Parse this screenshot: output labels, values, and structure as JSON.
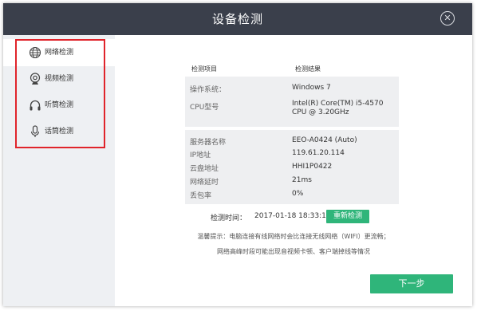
{
  "window": {
    "title": "设备检测"
  },
  "sidebar": {
    "items": [
      {
        "label": "网络检测",
        "icon": "globe-icon"
      },
      {
        "label": "视频检测",
        "icon": "webcam-icon"
      },
      {
        "label": "听筒检测",
        "icon": "headphones-icon"
      },
      {
        "label": "话筒检测",
        "icon": "microphone-icon"
      }
    ]
  },
  "table": {
    "col_item": "检测项目",
    "col_result": "检测结果"
  },
  "system": {
    "os_label": "操作系统：",
    "os_value": "Windows 7",
    "cpu_label": "CPU型号",
    "cpu_value_line1": "Intel(R) Core(TM) i5-4570",
    "cpu_value_line2": "CPU @ 3.20GHz"
  },
  "network": {
    "server_label": "服务器名称",
    "server_value": "EEO-A0424 (Auto)",
    "ip_label": "IP地址",
    "ip_value": "119.61.20.114",
    "cloud_label": "云盘地址",
    "cloud_value": "HHI1P0422",
    "latency_label": "网络延时",
    "latency_value": "21ms",
    "loss_label": "丢包率",
    "loss_value": "0%"
  },
  "check": {
    "time_label": "检测时间：",
    "time_value": "2017-01-18 18:33:15",
    "recheck_label": "重新检测"
  },
  "tips": {
    "line1": "温馨提示：电脑连接有线网络时会比连接无线网络（WIFI）更流畅；",
    "line2": "网络高峰时段可能出现音视频卡顿、客户端掉线等情况"
  },
  "footer": {
    "next_label": "下一步"
  },
  "colors": {
    "titlebar": "#3a3f4b",
    "accent": "#2fb57a",
    "highlight": "#e0242b",
    "sidebar_bg": "#eef0f3",
    "panel_bg": "#eeeff1"
  }
}
